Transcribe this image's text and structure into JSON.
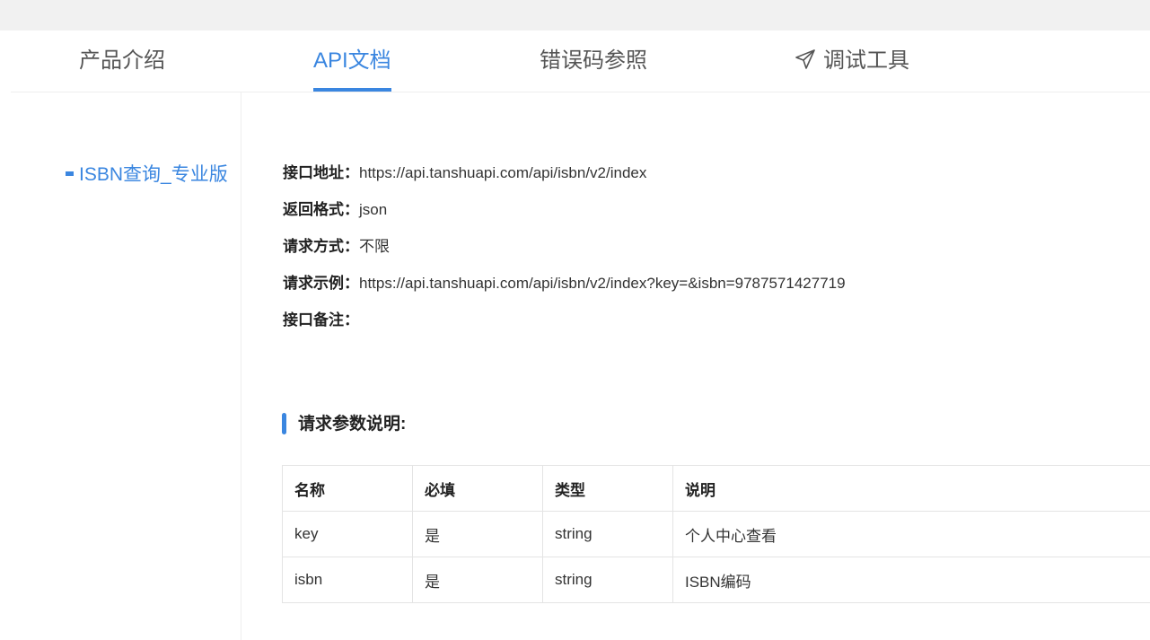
{
  "tabs": [
    {
      "label": "产品介绍",
      "active": false
    },
    {
      "label": "API文档",
      "active": true
    },
    {
      "label": "错误码参照",
      "active": false
    },
    {
      "label": "调试工具",
      "active": false,
      "icon": "send-icon"
    }
  ],
  "sidebar": {
    "items": [
      {
        "label": "ISBN查询_专业版",
        "active": true
      }
    ]
  },
  "info": {
    "endpoint_label": "接口地址：",
    "endpoint_value": "https://api.tanshuapi.com/api/isbn/v2/index",
    "format_label": "返回格式：",
    "format_value": "json",
    "method_label": "请求方式：",
    "method_value": "不限",
    "example_label": "请求示例：",
    "example_value": "https://api.tanshuapi.com/api/isbn/v2/index?key=&isbn=9787571427719",
    "remark_label": "接口备注：",
    "remark_value": ""
  },
  "params_section": {
    "title": "请求参数说明:",
    "headers": [
      "名称",
      "必填",
      "类型",
      "说明"
    ],
    "rows": [
      [
        "key",
        "是",
        "string",
        "个人中心查看"
      ],
      [
        "isbn",
        "是",
        "string",
        "ISBN编码"
      ]
    ]
  },
  "colors": {
    "accent": "#3a86e0",
    "topstrip": "#f1f1f1"
  }
}
